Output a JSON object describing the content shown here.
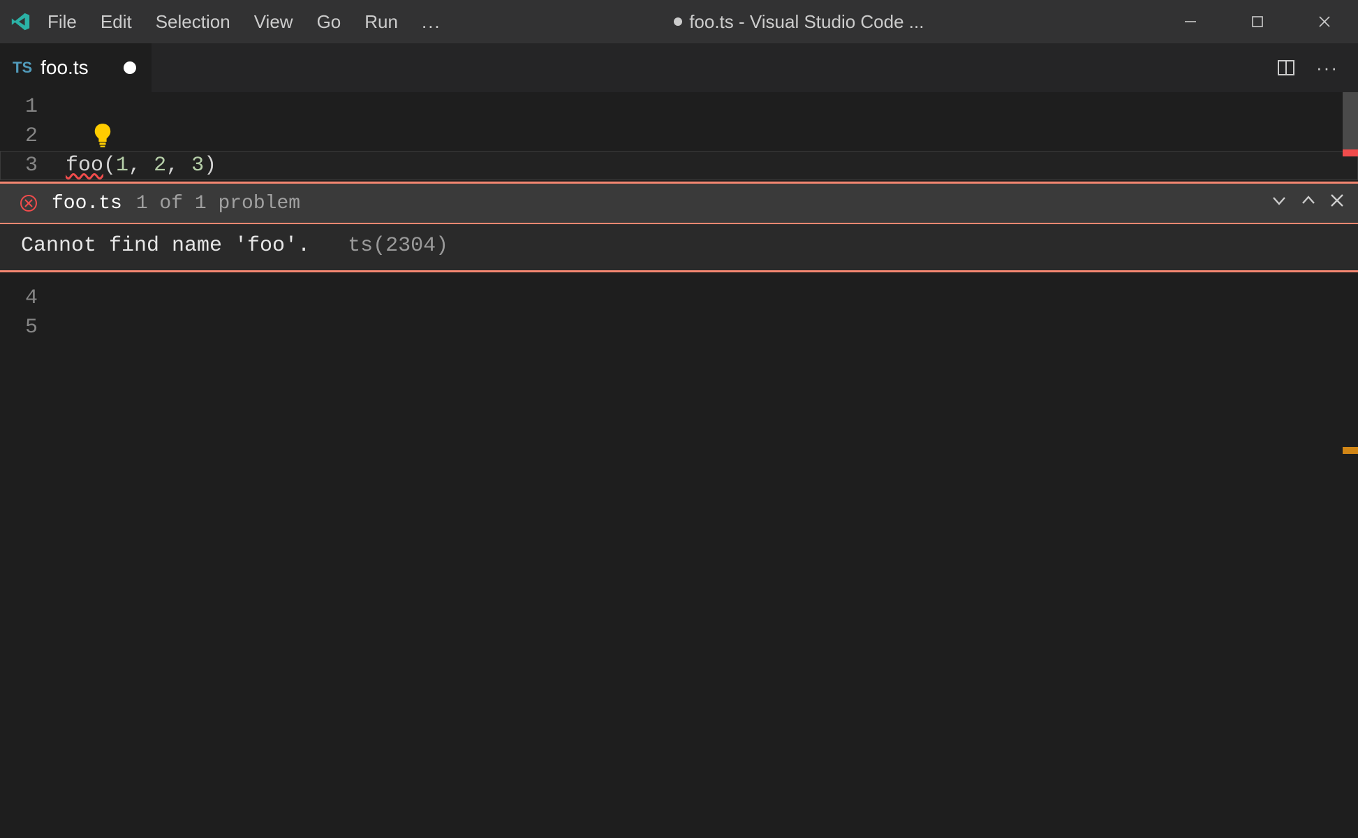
{
  "window": {
    "title_suffix": "foo.ts - Visual Studio Code ...",
    "dirty": true
  },
  "menu": {
    "items": [
      "File",
      "Edit",
      "Selection",
      "View",
      "Go",
      "Run"
    ],
    "overflow": "..."
  },
  "tab": {
    "lang_badge": "TS",
    "filename": "foo.ts",
    "dirty": true
  },
  "editor": {
    "lines": [
      {
        "num": "1",
        "text": ""
      },
      {
        "num": "2",
        "text": ""
      },
      {
        "num": "3",
        "tokens": {
          "fn": "foo",
          "open": "(",
          "args": [
            "1",
            "2",
            "3"
          ],
          "close": ")"
        },
        "error_on": "foo",
        "is_current": true
      },
      {
        "num": "4",
        "text": ""
      },
      {
        "num": "5",
        "text": ""
      }
    ],
    "lightbulb_on_line": 2
  },
  "peek": {
    "filename": "foo.ts",
    "counter": "1 of 1 problem",
    "message": "Cannot find name 'foo'.",
    "code": "ts(2304)"
  },
  "colors": {
    "peek_border": "#f48771",
    "error": "#f14c4c",
    "lang_badge": "#519aba",
    "number": "#b5cea8",
    "lightbulb": "#ffcc00",
    "logo": "#2bb2a6"
  }
}
